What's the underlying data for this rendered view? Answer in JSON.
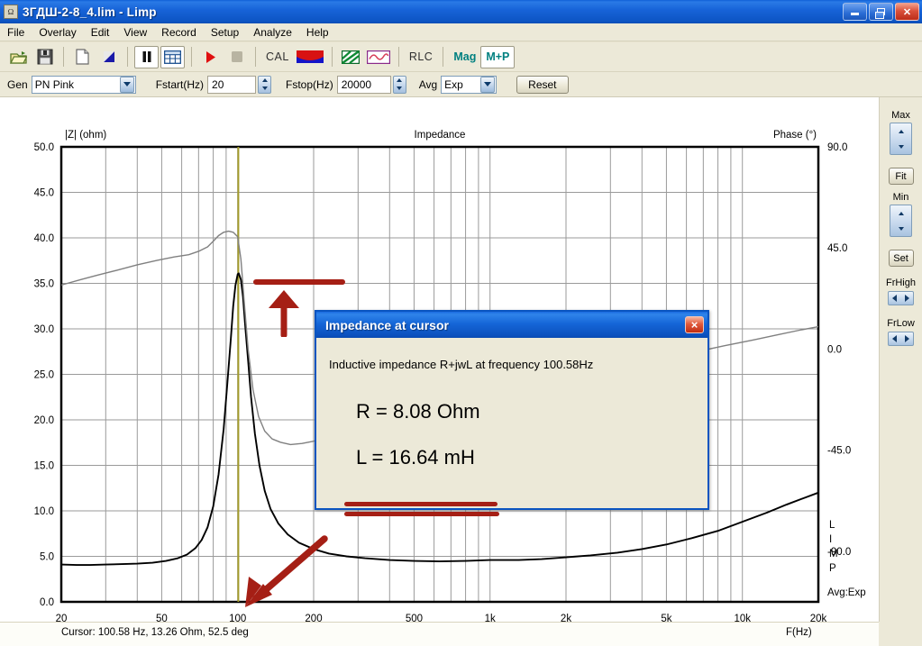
{
  "window": {
    "title": "3ГДШ-2-8_4.lim - Limp",
    "app_icon": "limp-app-icon",
    "minimize_label": "Minimize",
    "maximize_label": "Restore",
    "close_label": "Close"
  },
  "menubar": {
    "items": [
      {
        "label": "File"
      },
      {
        "label": "Overlay"
      },
      {
        "label": "Edit"
      },
      {
        "label": "View"
      },
      {
        "label": "Record"
      },
      {
        "label": "Setup"
      },
      {
        "label": "Analyze"
      },
      {
        "label": "Help"
      }
    ]
  },
  "toolbar": {
    "buttons": [
      {
        "name": "open-file-button",
        "icon": "folder-open-icon",
        "label": "",
        "state": "normal"
      },
      {
        "name": "save-file-button",
        "icon": "floppy-disk-icon",
        "label": "",
        "state": "normal"
      },
      {
        "name": "new-file-button",
        "icon": "page-icon",
        "label": "",
        "state": "normal"
      },
      {
        "name": "export-button",
        "icon": "triangle-fill-icon",
        "label": "",
        "state": "normal"
      },
      {
        "name": "pause-button",
        "icon": "pause-icon",
        "label": "",
        "state": "pressed"
      },
      {
        "name": "table-view-button",
        "icon": "table-grid-icon",
        "label": "",
        "state": "pressed"
      },
      {
        "name": "play-button",
        "icon": "play-icon",
        "label": "",
        "state": "normal"
      },
      {
        "name": "stop-button",
        "icon": "stop-icon",
        "label": "",
        "state": "disabled"
      },
      {
        "name": "cal-button",
        "icon": "cal-text-icon",
        "label": "CAL",
        "state": "normal"
      },
      {
        "name": "flag-button",
        "icon": "flag-red-blue-icon",
        "label": "",
        "state": "normal"
      },
      {
        "name": "hatch-button",
        "icon": "green-hatch-icon",
        "label": "",
        "state": "normal"
      },
      {
        "name": "sine-button",
        "icon": "sine-wave-icon",
        "label": "",
        "state": "normal"
      },
      {
        "name": "rlc-button",
        "icon": "rlc-text-icon",
        "label": "RLC",
        "state": "normal"
      },
      {
        "name": "mag-button",
        "icon": "mag-text-icon",
        "label": "Mag",
        "state": "normal"
      },
      {
        "name": "magphase-button",
        "icon": "m-plus-p-text-icon",
        "label": "M+P",
        "state": "pressed"
      }
    ]
  },
  "params": {
    "gen_label": "Gen",
    "gen_value": "PN Pink",
    "fstart_label": "Fstart(Hz)",
    "fstart_value": "20",
    "fstop_label": "Fstop(Hz)",
    "fstop_value": "20000",
    "avg_label": "Avg",
    "avg_value": "Exp",
    "reset_label": "Reset"
  },
  "sidepanel": {
    "max_label": "Max",
    "fit_label": "Fit",
    "min_label": "Min",
    "set_label": "Set",
    "frhigh_label": "FrHigh",
    "frlow_label": "FrLow"
  },
  "statusbar": {
    "cursor_text": "Cursor: 100.58 Hz, 13.26 Ohm, 52.5 deg",
    "xaxis_unit": "F(Hz)"
  },
  "dialog": {
    "title": "Impedance at cursor",
    "close_label": "×",
    "description": "Inductive impedance R+jwL at frequency 100.58Hz",
    "r_text": "R = 8.08 Ohm",
    "l_text": "L = 16.64 mH"
  },
  "annotations": {
    "avg_overlay": "Avg:Exp",
    "watermark": "LIMP",
    "watermark_chars": [
      "L",
      "I",
      "M",
      "P"
    ]
  },
  "colors": {
    "impedance_curve": "#000000",
    "phase_curve": "#808080",
    "cursor_line": "#a39b2a",
    "annotation_red": "#a51f15",
    "title_blue": "#1763d8",
    "panel_bg": "#ece9d8",
    "plot_bg": "#ffffff",
    "grid": "#9a9a9a"
  },
  "chart_data": {
    "type": "line",
    "title": "Impedance",
    "xlabel": "F(Hz)",
    "ylabel": "|Z| (ohm)",
    "y2label": "Phase (°)",
    "xscale": "log",
    "xlim": [
      20,
      20000
    ],
    "ylim": [
      0.0,
      50.0
    ],
    "y2lim": [
      -112.5,
      90.0
    ],
    "grid": true,
    "legend": "none",
    "xticks": [
      "20",
      "50",
      "100",
      "200",
      "500",
      "1k",
      "2k",
      "5k",
      "10k",
      "20k"
    ],
    "xtick_values": [
      20,
      50,
      100,
      200,
      500,
      1000,
      2000,
      5000,
      10000,
      20000
    ],
    "yticks": [
      "0.0",
      "5.0",
      "10.0",
      "15.0",
      "20.0",
      "25.0",
      "30.0",
      "35.0",
      "40.0",
      "45.0",
      "50.0"
    ],
    "ytick_values": [
      0,
      5,
      10,
      15,
      20,
      25,
      30,
      35,
      40,
      45,
      50
    ],
    "y2ticks": [
      "-90.0",
      "-45.0",
      "0.0",
      "45.0",
      "90.0"
    ],
    "y2tick_values": [
      -90,
      -45,
      0,
      45,
      90
    ],
    "cursor": {
      "frequency_hz": 100.58,
      "impedance_ohm": 13.26,
      "phase_deg": 52.5
    },
    "series": [
      {
        "name": "Impedance |Z|",
        "axis": "left",
        "unit": "ohm",
        "color": "#000000",
        "x": [
          20,
          23,
          26,
          30,
          35,
          40,
          46,
          52,
          58,
          63,
          68,
          72,
          76,
          80,
          84,
          88,
          91,
          94,
          96,
          98,
          100,
          101,
          103,
          105,
          107,
          110,
          113,
          117,
          122,
          128,
          135,
          145,
          158,
          175,
          200,
          230,
          270,
          320,
          400,
          500,
          630,
          800,
          1000,
          1300,
          1600,
          2000,
          2500,
          3200,
          4000,
          5000,
          6300,
          8000,
          10000,
          12500,
          15000,
          17500,
          20000
        ],
        "y": [
          4.1,
          4.05,
          4.05,
          4.1,
          4.15,
          4.2,
          4.3,
          4.5,
          4.8,
          5.2,
          5.9,
          6.8,
          8.2,
          10.5,
          14.0,
          19.0,
          24.0,
          29.0,
          32.5,
          34.8,
          36.0,
          36.1,
          35.4,
          33.5,
          30.5,
          26.5,
          22.5,
          18.5,
          15.0,
          12.2,
          10.2,
          8.6,
          7.4,
          6.5,
          5.8,
          5.3,
          5.0,
          4.8,
          4.6,
          4.5,
          4.45,
          4.5,
          4.6,
          4.6,
          4.7,
          4.9,
          5.1,
          5.4,
          5.8,
          6.3,
          7.0,
          7.8,
          8.8,
          9.8,
          10.7,
          11.4,
          12.0
        ]
      },
      {
        "name": "Phase",
        "axis": "right",
        "unit": "deg",
        "color": "#808080",
        "x": [
          20,
          24,
          28,
          33,
          40,
          48,
          56,
          64,
          70,
          76,
          80,
          84,
          88,
          92,
          96,
          100,
          103,
          106,
          110,
          115,
          121,
          128,
          137,
          148,
          162,
          180,
          200,
          225,
          255,
          290,
          330,
          380,
          450,
          550,
          700,
          900,
          1200,
          1600,
          2000,
          2600,
          3300,
          4200,
          5300,
          6700,
          8500,
          11000,
          14000,
          17000,
          20000
        ],
        "y": [
          28.5,
          31.0,
          33.0,
          35.0,
          37.5,
          39.5,
          41.0,
          42.0,
          43.5,
          45.5,
          48.0,
          50.5,
          52.0,
          52.5,
          52.0,
          50.0,
          40.0,
          22.0,
          0.0,
          -18.0,
          -30.0,
          -36.5,
          -40.0,
          -41.5,
          -42.5,
          -42.0,
          -41.0,
          -39.5,
          -38.0,
          -36.5,
          -35.0,
          -33.5,
          -31.5,
          -29.0,
          -25.5,
          -22.5,
          -19.0,
          -15.0,
          -13.0,
          -10.5,
          -8.0,
          -5.5,
          -3.0,
          -1.0,
          1.5,
          4.0,
          6.5,
          8.5,
          10.0
        ]
      }
    ],
    "annotations": [
      {
        "name": "peak-marker-bar",
        "type": "bar",
        "color": "#a51f15",
        "target": "impedance resonance peak"
      },
      {
        "name": "peak-arrow",
        "type": "arrow-up",
        "color": "#a51f15"
      },
      {
        "name": "cursor-arrow",
        "type": "arrow-diagonal",
        "color": "#a51f15",
        "target": "cursor frequency 100.58 Hz"
      },
      {
        "name": "dialog-underline-1",
        "type": "underline",
        "color": "#a51f15"
      },
      {
        "name": "dialog-underline-2",
        "type": "underline",
        "color": "#a51f15"
      }
    ]
  }
}
